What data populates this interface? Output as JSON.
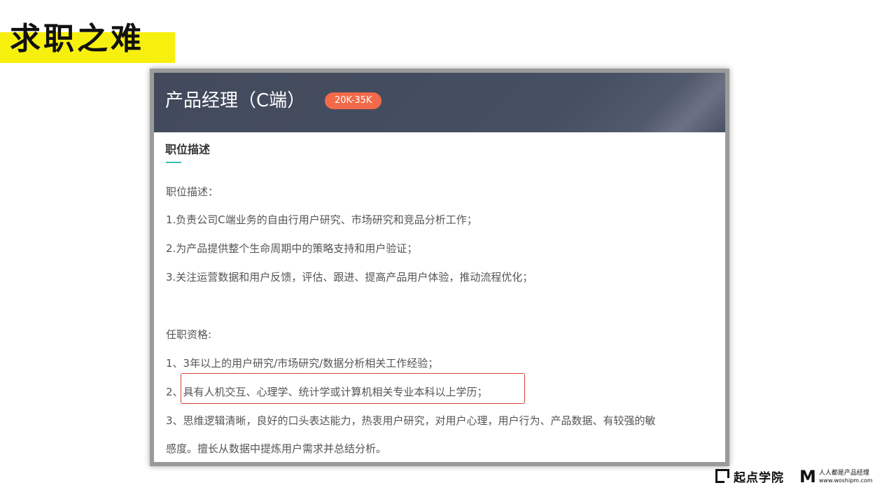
{
  "slide": {
    "title": "求职之难",
    "title_bg_color": "#f7f00f"
  },
  "job": {
    "title": "产品经理（C端）",
    "salary": "20K-35K",
    "salary_color": "#f26a4a",
    "header_color": "#424a5c",
    "section_title": "职位描述",
    "accent_color": "#33c2b0",
    "lines": [
      "职位描述：",
      "1.负责公司C端业务的自由行用户研究、市场研究和竞品分析工作；",
      "2.为产品提供整个生命周期中的策略支持和用户验证；",
      "3.关注运营数据和用户反馈，评估、跟进、提高产品用户体验，推动流程优化；",
      "任职资格:",
      "1、3年以上的用户研究/市场研究/数据分析相关工作经验；",
      "2、具有人机交互、心理学、统计学或计算机相关专业本科以上学历；",
      "3、思维逻辑清晰，良好的口头表达能力，热衷用户研究，对用户心理，用户行为、产品数据、有较强的敏",
      "感度。擅长从数据中提炼用户需求并总结分析。"
    ],
    "highlight_color": "#d9463a"
  },
  "footer": {
    "qidian_logo": "起点学院",
    "woshipm_logo_mark": "M",
    "woshipm_logo_name": "人人都是产品经理",
    "woshipm_logo_url": "www.woshipm.com"
  }
}
